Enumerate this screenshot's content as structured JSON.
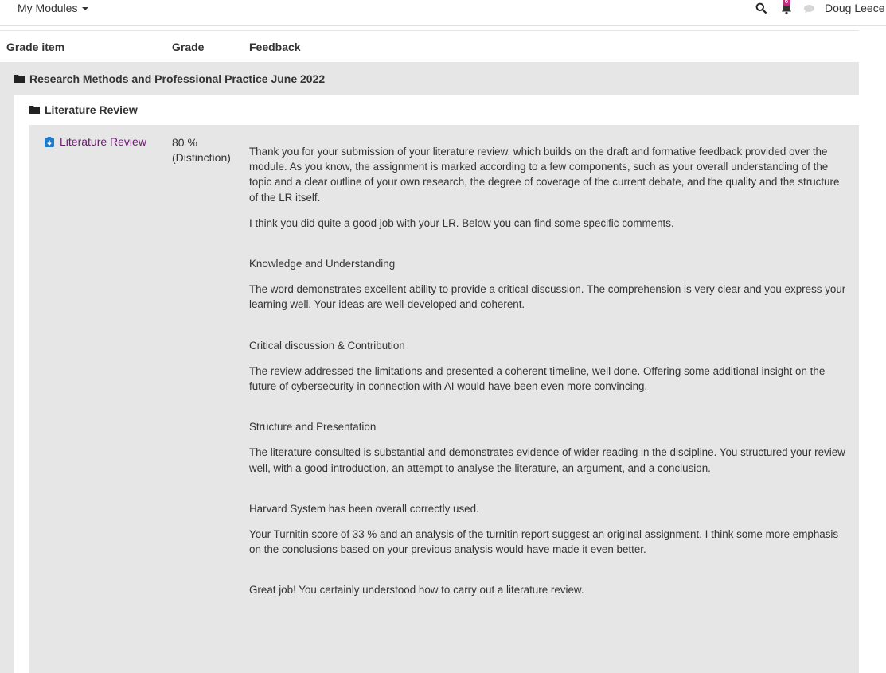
{
  "nav": {
    "modules_label": "My Modules",
    "notification_count": "6",
    "user_name": "Doug Leece"
  },
  "table": {
    "headers": {
      "grade_item": "Grade item",
      "grade": "Grade",
      "feedback": "Feedback"
    }
  },
  "category": {
    "title": "Research Methods and Professional Practice June 2022"
  },
  "subcategory": {
    "title": "Literature Review"
  },
  "item": {
    "name": "Literature Review",
    "grade": "80 %",
    "grade_label": "(Distinction)"
  },
  "feedback": {
    "intro": "Thank you for your submission of your literature review, which builds on the draft and formative feedback provided over the module. As you know, the assignment is marked according to a few components, such as your overall understanding of the topic and a clear outline of your own research, the degree of coverage of the current debate, and the quality and the structure of the LR itself.",
    "summary": "I think you did quite a good job with your LR. Below you can find some specific comments.",
    "s1_heading": "Knowledge and Understanding",
    "s1_body": "The word demonstrates excellent ability to provide a critical discussion. The comprehension is very clear and you express your learning well. Your ideas are well-developed and coherent.",
    "s2_heading": "Critical discussion & Contribution",
    "s2_body": "The review addressed the limitations and presented a coherent timeline, well done. Offering some additional insight on the future of cybersecurity in connection with AI would have been even more convincing.",
    "s3_heading": "Structure and Presentation",
    "s3_body": "The literature consulted is substantial and demonstrates evidence of wider reading in the discipline. You structured your review well, with a good introduction, an attempt to analyse the literature, an argument, and a conclusion.",
    "s4_heading": "Harvard System has been overall correctly used.",
    "s4_body": "Your Turnitin score of 33 % and an analysis of the turnitin report suggest an original assignment.  I think some more emphasis on the conclusions based on your previous analysis would have made it even better.",
    "closing": "Great job! You certainly understood how to carry out a literature review."
  },
  "colors": {
    "link": "#6a1b6e",
    "badge": "#c62a7d",
    "row_bg": "#e6e6e6",
    "assign_icon": "#1f7ac9"
  }
}
